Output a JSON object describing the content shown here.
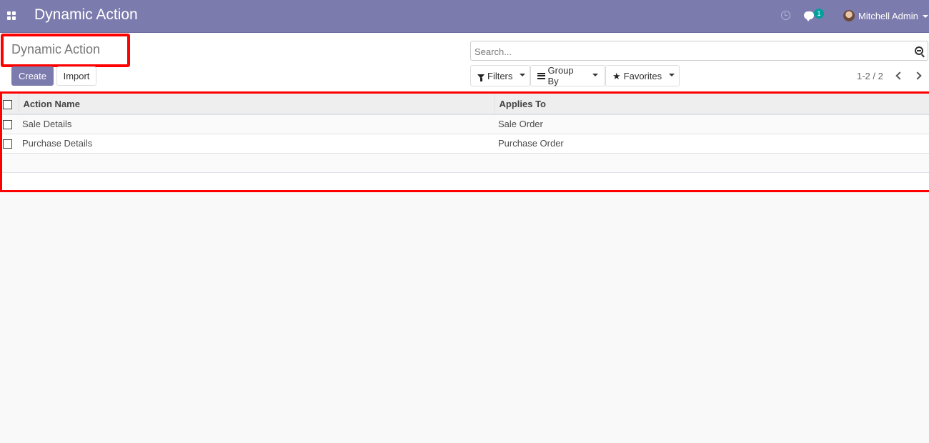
{
  "navbar": {
    "app_title": "Dynamic Action",
    "chat_badge_count": "1",
    "user_name": "Mitchell Admin"
  },
  "control_panel": {
    "breadcrumb": "Dynamic Action",
    "create_label": "Create",
    "import_label": "Import",
    "search_placeholder": "Search...",
    "filters_label": "Filters",
    "groupby_label": "Group By",
    "favorites_label": "Favorites",
    "pager": "1-2 / 2"
  },
  "list": {
    "columns": [
      "Action Name",
      "Applies To"
    ],
    "rows": [
      {
        "action_name": "Sale Details",
        "applies_to": "Sale Order"
      },
      {
        "action_name": "Purchase Details",
        "applies_to": "Purchase Order"
      }
    ]
  },
  "colors": {
    "brand": "#7c7bad",
    "highlight": "#ff0000",
    "badge": "#00a09d"
  }
}
